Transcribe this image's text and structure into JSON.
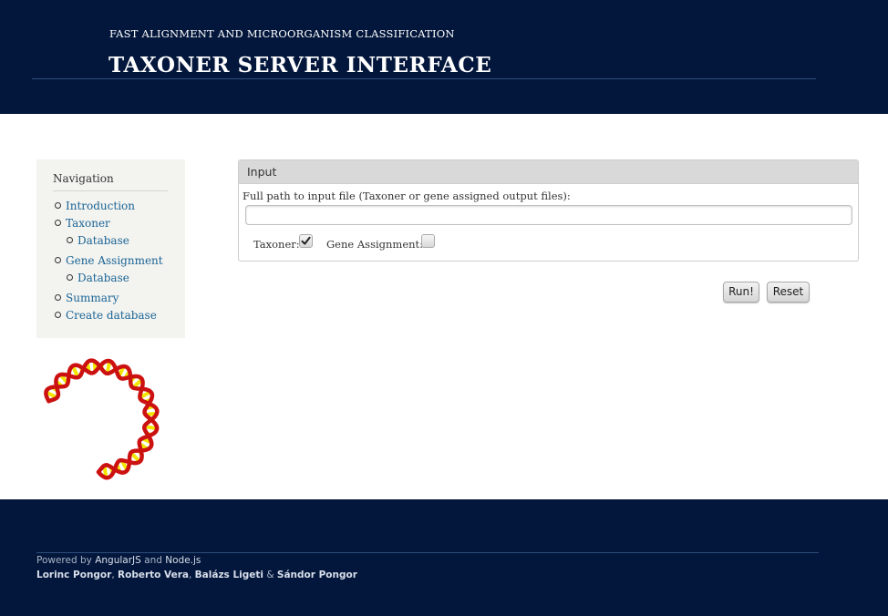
{
  "header": {
    "subtitle": "FAST ALIGNMENT AND MICROORGANISM CLASSIFICATION",
    "title": "TAXONER SERVER INTERFACE"
  },
  "nav": {
    "title": "Navigation",
    "items": [
      {
        "label": "Introduction",
        "level": 1
      },
      {
        "label": "Taxoner",
        "level": 1
      },
      {
        "label": "Database",
        "level": 2
      },
      {
        "label": "Gene Assignment",
        "level": 1
      },
      {
        "label": "Database",
        "level": 2
      },
      {
        "label": "Summary",
        "level": 1
      },
      {
        "label": "Create database",
        "level": 1
      }
    ]
  },
  "input_panel": {
    "heading": "Input",
    "path_label": "Full path to input file (Taxoner or gene assigned output files):",
    "path_value": "",
    "taxoner_label": "Taxoner:",
    "taxoner_checked": true,
    "gene_label": "Gene Assignment:",
    "gene_checked": false
  },
  "buttons": {
    "run": "Run!",
    "reset": "Reset"
  },
  "footer": {
    "powered_prefix": "Powered by",
    "tech1": "AngularJS",
    "and": "and",
    "tech2": "Node.js",
    "authors": [
      "Lorinc Pongor",
      "Roberto Vera",
      "Balázs Ligeti",
      "Sándor Pongor"
    ],
    "sep1": ",",
    "sep2": ",",
    "sep3": "&"
  },
  "colors": {
    "header_bg": "#03173c",
    "link": "#1a6496",
    "helix_red": "#cc1111",
    "helix_yellow": "#f2e600"
  },
  "icons": [
    "checkmark-icon",
    "dna-helix-logo"
  ]
}
